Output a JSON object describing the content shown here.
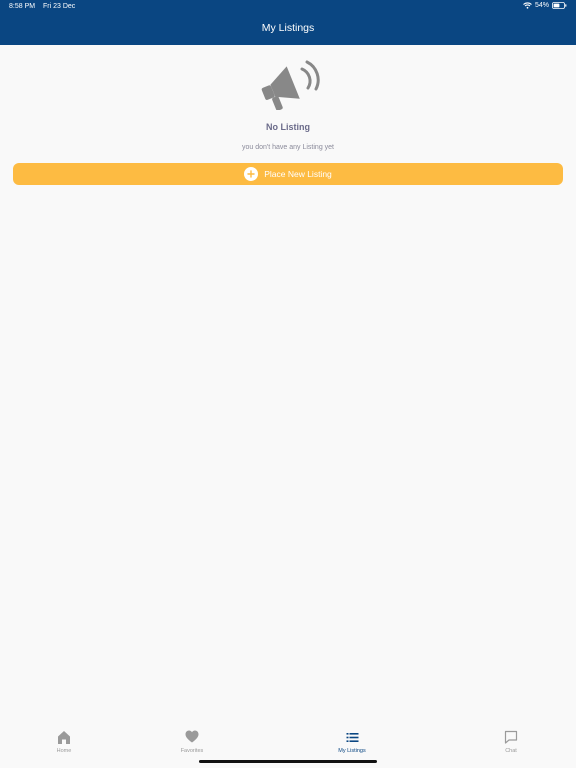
{
  "status_bar": {
    "time": "8:58 PM",
    "date": "Fri 23 Dec",
    "battery": "54%"
  },
  "header": {
    "title": "My Listings"
  },
  "empty_state": {
    "icon": "megaphone-icon",
    "title": "No Listing",
    "subtitle": "you don't have any Listing yet"
  },
  "action": {
    "label": "Place New Listing",
    "icon": "plus-icon"
  },
  "tabs": [
    {
      "label": "Home",
      "icon": "home-icon",
      "active": false
    },
    {
      "label": "Favorites",
      "icon": "heart-icon",
      "active": false
    },
    {
      "label": "My Listings",
      "icon": "list-icon",
      "active": true
    },
    {
      "label": "Chat",
      "icon": "chat-icon",
      "active": false
    }
  ],
  "colors": {
    "header": "#0a4682",
    "accent": "#fdbb42",
    "background": "#f9f9f9"
  }
}
